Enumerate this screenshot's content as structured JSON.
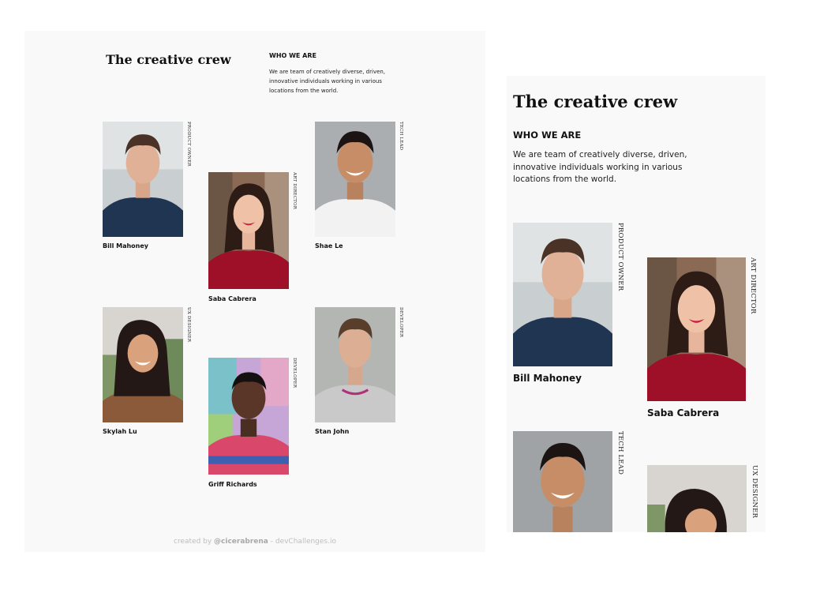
{
  "page": {
    "title": "The creative crew",
    "subtitle": "WHO WE ARE",
    "description": "We are team of creatively diverse, driven, innovative individuals working in various locations from the world."
  },
  "members": [
    {
      "name": "Bill Mahoney",
      "role": "PRODUCT OWNER"
    },
    {
      "name": "Saba Cabrera",
      "role": "ART DIRECTOR"
    },
    {
      "name": "Shae Le",
      "role": "TECH LEAD"
    },
    {
      "name": "Skylah Lu",
      "role": "UX DESIGNER"
    },
    {
      "name": "Griff Richards",
      "role": "DEVELOPER"
    },
    {
      "name": "Stan John",
      "role": "DEVELOPER"
    }
  ],
  "footer": {
    "prefix": "created by ",
    "author": "@cicerabrena",
    "suffix": " - devChallenges.io"
  },
  "colors": {
    "panel_bg": "#f9f9f9",
    "text": "#111111",
    "footer_text": "#bdbdbd"
  }
}
